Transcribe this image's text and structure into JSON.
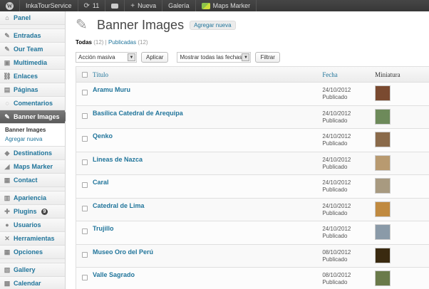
{
  "adminbar": {
    "site_name": "InkaTourService",
    "updates_count": "11",
    "new_label": "Nueva",
    "gallery_label": "Galería",
    "maps_marker_label": "Maps Marker"
  },
  "sidebar": {
    "items": [
      {
        "label": "Panel",
        "icon": "dashboard-icon",
        "glyph": "⌂"
      },
      {
        "sep": true
      },
      {
        "label": "Entradas",
        "icon": "pin-icon",
        "glyph": "✎"
      },
      {
        "label": "Our Team",
        "icon": "pin-icon",
        "glyph": "✎"
      },
      {
        "label": "Multimedia",
        "icon": "media-icon",
        "glyph": "▣"
      },
      {
        "label": "Enlaces",
        "icon": "links-icon",
        "glyph": "⛓"
      },
      {
        "label": "Páginas",
        "icon": "pages-icon",
        "glyph": "▤"
      },
      {
        "label": "Comentarios",
        "icon": "comments-icon",
        "glyph": "◌"
      },
      {
        "label": "Banner Images",
        "icon": "pin-icon",
        "glyph": "✎",
        "current": true
      },
      {
        "submenu": [
          "Banner Images",
          "Agregar nueva"
        ]
      },
      {
        "label": "Destinations",
        "icon": "pin-icon",
        "glyph": "◆"
      },
      {
        "label": "Maps Marker",
        "icon": "map-icon",
        "glyph": "◢"
      },
      {
        "label": "Contact",
        "icon": "contact-icon",
        "glyph": "▦"
      },
      {
        "sep": true
      },
      {
        "label": "Apariencia",
        "icon": "appearance-icon",
        "glyph": "▥"
      },
      {
        "label": "Plugins",
        "icon": "plugins-icon",
        "glyph": "✚",
        "badge": "9"
      },
      {
        "label": "Usuarios",
        "icon": "users-icon",
        "glyph": "●"
      },
      {
        "label": "Herramientas",
        "icon": "tools-icon",
        "glyph": "✕"
      },
      {
        "label": "Opciones",
        "icon": "settings-icon",
        "glyph": "▦"
      },
      {
        "sep": true
      },
      {
        "label": "Gallery",
        "icon": "gallery-icon",
        "glyph": "▧"
      },
      {
        "label": "Calendar",
        "icon": "calendar-icon",
        "glyph": "▩"
      }
    ]
  },
  "page": {
    "title": "Banner Images",
    "add_new": "Agregar nueva",
    "filter_all": "Todas",
    "filter_all_count": "(12)",
    "filter_published": "Publicadas",
    "filter_published_count": "(12)",
    "bulk_action": "Acción masiva",
    "apply": "Aplicar",
    "date_filter": "Mostrar todas las fechas",
    "filter_btn": "Filtrar"
  },
  "table": {
    "columns": {
      "title": "Título",
      "date": "Fecha",
      "thumb": "Miniatura"
    },
    "rows": [
      {
        "title": "Aramu Muru",
        "date": "24/10/2012",
        "status": "Publicado",
        "thumb": "#7a4a30"
      },
      {
        "title": "Basílica Catedral de Arequipa",
        "date": "24/10/2012",
        "status": "Publicado",
        "thumb": "#6d8a5a"
      },
      {
        "title": "Qenko",
        "date": "24/10/2012",
        "status": "Publicado",
        "thumb": "#8a6a4a"
      },
      {
        "title": "Lineas de Nazca",
        "date": "24/10/2012",
        "status": "Publicado",
        "thumb": "#b89a70"
      },
      {
        "title": "Caral",
        "date": "24/10/2012",
        "status": "Publicado",
        "thumb": "#a89a80"
      },
      {
        "title": "Catedral de Lima",
        "date": "24/10/2012",
        "status": "Publicado",
        "thumb": "#c08a40"
      },
      {
        "title": "Trujillo",
        "date": "24/10/2012",
        "status": "Publicado",
        "thumb": "#8a9aa8"
      },
      {
        "title": "Museo Oro del Perú",
        "date": "08/10/2012",
        "status": "Publicado",
        "thumb": "#3a2a10"
      },
      {
        "title": "Valle Sagrado",
        "date": "08/10/2012",
        "status": "Publicado",
        "thumb": "#6a7a4a"
      }
    ]
  }
}
